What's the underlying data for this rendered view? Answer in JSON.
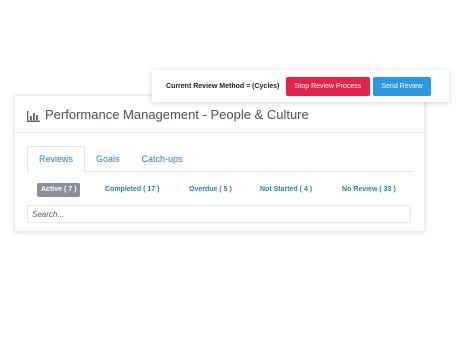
{
  "header": {
    "method_label": "Current Review Method = (Cycles)",
    "stop_label": "Stop Review Process",
    "send_label": "Send Review"
  },
  "panel": {
    "icon": "bar-chart-icon",
    "title": "Performance Management - People & Culture"
  },
  "tabs": [
    {
      "label": "Reviews",
      "active": true
    },
    {
      "label": "Goals",
      "active": false
    },
    {
      "label": "Catch-ups",
      "active": false
    }
  ],
  "filters": [
    {
      "label": "Active ( 7 )",
      "active": true
    },
    {
      "label": "Completed ( 17 )",
      "active": false
    },
    {
      "label": "Overdue ( 5 )",
      "active": false
    },
    {
      "label": "Not Started ( 4 )",
      "active": false
    },
    {
      "label": "No Review ( 33 )",
      "active": false
    }
  ],
  "search": {
    "placeholder": "Search..."
  },
  "colors": {
    "primary_link": "#1f7fc2",
    "stop_button": "#e5244e",
    "send_button": "#2a9ae0",
    "active_filter": "#8a9097"
  }
}
